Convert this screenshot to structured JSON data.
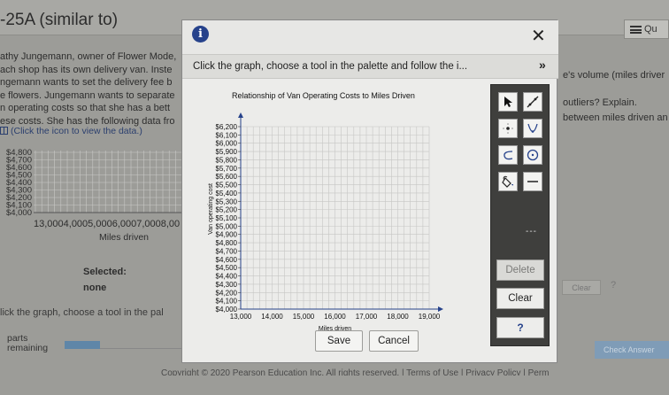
{
  "background": {
    "question_title": "-25A (similar to)",
    "question_menu_label": "Qu",
    "problem_lines": [
      "athy Jungemann, owner of Flower Mode,",
      "ach shop has its own delivery van. Inste",
      "ngemann wants to set the delivery fee b",
      "e flowers. Jungemann wants to separate",
      "n operating costs so that she has a bett",
      "ese costs. She has the following data fro"
    ],
    "data_link": "(Click the icon to view the data.)",
    "right_text_1": "e's volume (miles driver",
    "right_text_2": "outliers? Explain.",
    "right_text_3": "between miles driven an",
    "mini_chart_labels": [
      "$4,800",
      "$4,700",
      "$4,600",
      "$4,500",
      "$4,400",
      "$4,300",
      "$4,200",
      "$4,100",
      "$4,000"
    ],
    "mini_x_axis_text": "13,0004,0005,0006,0007,0008,00",
    "mini_x_caption": "Miles driven",
    "selected_label": "Selected:",
    "selected_value": "none",
    "instruction": "lick the graph, choose a tool in the pal",
    "parts_label": "parts",
    "remaining_label": "remaining",
    "clear_label": "Clear",
    "help_label": "?",
    "check_label": "Check Answer",
    "footer": "Copyright © 2020 Pearson Education Inc. All rights reserved. | Terms of Use | Privacy Policy | Perm"
  },
  "dialog": {
    "info_icon": "info-icon",
    "close_symbol": "✕",
    "instruction": "Click the graph, choose a tool in the palette and follow the i...",
    "expand_symbol": "»",
    "palette": {
      "delete_label": "Delete",
      "clear_label": "Clear",
      "help_label": "?",
      "more_symbol": "---"
    },
    "save_label": "Save",
    "cancel_label": "Cancel"
  },
  "chart_data": {
    "type": "scatter",
    "title": "Relationship of Van Operating Costs to Miles Driven",
    "xlabel": "Miles driven",
    "ylabel": "Van operating cost",
    "xlim": [
      13000,
      19000
    ],
    "ylim": [
      4000,
      6200
    ],
    "x_ticks": [
      "13,000",
      "14,000",
      "15,000",
      "16,000",
      "17,000",
      "18,000",
      "19,000"
    ],
    "y_ticks": [
      "$4,000",
      "$4,100",
      "$4,200",
      "$4,300",
      "$4,400",
      "$4,500",
      "$4,600",
      "$4,700",
      "$4,800",
      "$4,900",
      "$5,000",
      "$5,100",
      "$5,200",
      "$5,300",
      "$5,400",
      "$5,500",
      "$5,600",
      "$5,700",
      "$5,800",
      "$5,900",
      "$6,000",
      "$6,100",
      "$6,200"
    ],
    "grid": true,
    "points": []
  }
}
